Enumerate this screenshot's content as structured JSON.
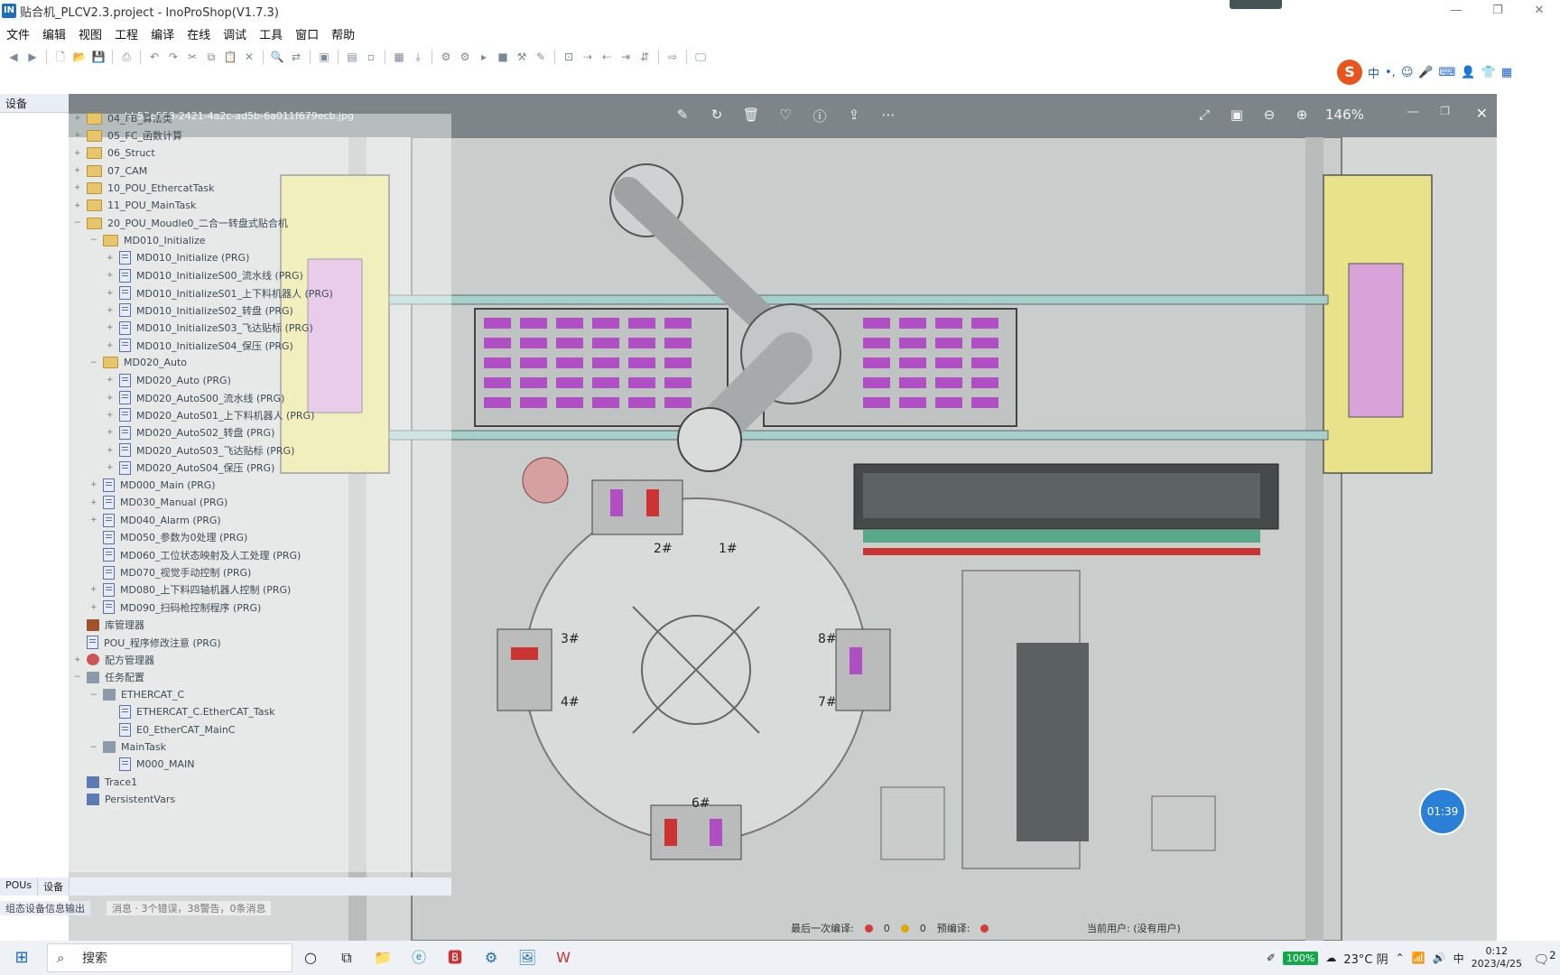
{
  "window": {
    "title": "贴合机_PLCV2.3.project - InoProShop(V1.7.3)",
    "controls": [
      "—",
      "❐",
      "✕"
    ]
  },
  "menu": [
    "文件",
    "编辑",
    "视图",
    "工程",
    "编译",
    "在线",
    "调试",
    "工具",
    "窗口",
    "帮助"
  ],
  "toolbar_icons": [
    "back-icon",
    "forward-icon",
    "new-icon",
    "open-icon",
    "save-icon",
    "print-icon",
    "undo-icon",
    "redo-icon",
    "cut-icon",
    "copy-icon",
    "paste-icon",
    "delete-icon",
    "find-icon",
    "replace-icon",
    "window-icon",
    "object-icon",
    "property-icon",
    "build-icon",
    "download-icon",
    "login-icon",
    "logout-icon",
    "run-icon",
    "stop-icon",
    "tools-icon",
    "edit-icon",
    "breakpoint-icon",
    "step-icon",
    "step-out-icon",
    "monitor-icon",
    "forcing-icon",
    "arrow-icon",
    "screen-icon"
  ],
  "ime": {
    "logo": "S",
    "items": [
      "中",
      "•,",
      "☺",
      "🎤",
      "⌨",
      "👤",
      "👕",
      "▦"
    ]
  },
  "panel": {
    "title": "设备",
    "pin": "▾ 🖈 ✕"
  },
  "viewer": {
    "filename": "bb53e558-2421-4a2c-ad5b-6a011f679ecb.jpg",
    "zoom": "146%",
    "timer": "01:39"
  },
  "tree": [
    {
      "label": "04_FB_算法类",
      "depth": 0,
      "type": "folder",
      "toggle": "+"
    },
    {
      "label": "05_FC_函数计算",
      "depth": 0,
      "type": "folder",
      "toggle": "+"
    },
    {
      "label": "06_Struct",
      "depth": 0,
      "type": "folder",
      "toggle": "+"
    },
    {
      "label": "07_CAM",
      "depth": 0,
      "type": "folder",
      "toggle": "+"
    },
    {
      "label": "10_POU_EthercatTask",
      "depth": 0,
      "type": "folder",
      "toggle": "+"
    },
    {
      "label": "11_POU_MainTask",
      "depth": 0,
      "type": "folder",
      "toggle": "+"
    },
    {
      "label": "20_POU_Moudle0_二合一转盘式贴合机",
      "depth": 0,
      "type": "folder",
      "toggle": "−"
    },
    {
      "label": "MD010_Initialize",
      "depth": 1,
      "type": "folder",
      "toggle": "−"
    },
    {
      "label": "MD010_Initialize (PRG)",
      "depth": 2,
      "type": "prg",
      "toggle": "+"
    },
    {
      "label": "MD010_InitializeS00_流水线 (PRG)",
      "depth": 2,
      "type": "prg",
      "toggle": "+"
    },
    {
      "label": "MD010_InitializeS01_上下料机器人 (PRG)",
      "depth": 2,
      "type": "prg",
      "toggle": "+"
    },
    {
      "label": "MD010_InitializeS02_转盘 (PRG)",
      "depth": 2,
      "type": "prg",
      "toggle": "+"
    },
    {
      "label": "MD010_InitializeS03_飞达贴标 (PRG)",
      "depth": 2,
      "type": "prg",
      "toggle": "+"
    },
    {
      "label": "MD010_InitializeS04_保压 (PRG)",
      "depth": 2,
      "type": "prg",
      "toggle": "+"
    },
    {
      "label": "MD020_Auto",
      "depth": 1,
      "type": "folder",
      "toggle": "−"
    },
    {
      "label": "MD020_Auto (PRG)",
      "depth": 2,
      "type": "prg",
      "toggle": "+"
    },
    {
      "label": "MD020_AutoS00_流水线 (PRG)",
      "depth": 2,
      "type": "prg",
      "toggle": "+"
    },
    {
      "label": "MD020_AutoS01_上下料机器人 (PRG)",
      "depth": 2,
      "type": "prg",
      "toggle": "+"
    },
    {
      "label": "MD020_AutoS02_转盘 (PRG)",
      "depth": 2,
      "type": "prg",
      "toggle": "+"
    },
    {
      "label": "MD020_AutoS03_飞达贴标 (PRG)",
      "depth": 2,
      "type": "prg",
      "toggle": "+"
    },
    {
      "label": "MD020_AutoS04_保压 (PRG)",
      "depth": 2,
      "type": "prg",
      "toggle": "+"
    },
    {
      "label": "MD000_Main (PRG)",
      "depth": 1,
      "type": "prg",
      "toggle": "+"
    },
    {
      "label": "MD030_Manual (PRG)",
      "depth": 1,
      "type": "prg",
      "toggle": "+"
    },
    {
      "label": "MD040_Alarm (PRG)",
      "depth": 1,
      "type": "prg",
      "toggle": "+"
    },
    {
      "label": "MD050_参数为0处理 (PRG)",
      "depth": 1,
      "type": "prg",
      "toggle": ""
    },
    {
      "label": "MD060_工位状态映射及人工处理 (PRG)",
      "depth": 1,
      "type": "prg",
      "toggle": ""
    },
    {
      "label": "MD070_视觉手动控制 (PRG)",
      "depth": 1,
      "type": "prg",
      "toggle": ""
    },
    {
      "label": "MD080_上下料四轴机器人控制 (PRG)",
      "depth": 1,
      "type": "prg",
      "toggle": "+"
    },
    {
      "label": "MD090_扫码枪控制程序 (PRG)",
      "depth": 1,
      "type": "prg",
      "toggle": "+"
    },
    {
      "label": "库管理器",
      "depth": 0,
      "type": "lib",
      "toggle": ""
    },
    {
      "label": "POU_程序修改注意 (PRG)",
      "depth": 0,
      "type": "prg",
      "toggle": ""
    },
    {
      "label": "配方管理器",
      "depth": 0,
      "type": "cfg",
      "toggle": "+"
    },
    {
      "label": "任务配置",
      "depth": 0,
      "type": "task",
      "toggle": "−"
    },
    {
      "label": "ETHERCAT_C",
      "depth": 1,
      "type": "task",
      "toggle": "−"
    },
    {
      "label": "ETHERCAT_C.EtherCAT_Task",
      "depth": 2,
      "type": "prg",
      "toggle": ""
    },
    {
      "label": "E0_EtherCAT_MainC",
      "depth": 2,
      "type": "prg",
      "toggle": ""
    },
    {
      "label": "MainTask",
      "depth": 1,
      "type": "task",
      "toggle": "−"
    },
    {
      "label": "M000_MAIN",
      "depth": 2,
      "type": "prg",
      "toggle": ""
    },
    {
      "label": "Trace1",
      "depth": 0,
      "type": "trace",
      "toggle": ""
    },
    {
      "label": "PersistentVars",
      "depth": 0,
      "type": "trace",
      "toggle": ""
    }
  ],
  "bottom_tabs": [
    "POUs",
    "设备"
  ],
  "status": {
    "device_output": "组态设备信息输出",
    "messages": "消息 · 3个错误，38警告，0条消息",
    "last_build": "最后一次编译:",
    "errors": "0",
    "warnings": "0",
    "precompile": "预编译:",
    "user": "当前用户: (没有用户)"
  },
  "taskbar": {
    "search_placeholder": "搜索",
    "battery": "100%",
    "weather": "23°C 阴",
    "ime_indicator": "中",
    "time": "0:12",
    "date": "2023/4/25",
    "notifications": "2"
  },
  "drawing_labels": [
    "2#",
    "1#",
    "3#",
    "4#",
    "7#",
    "8#",
    "6#"
  ]
}
